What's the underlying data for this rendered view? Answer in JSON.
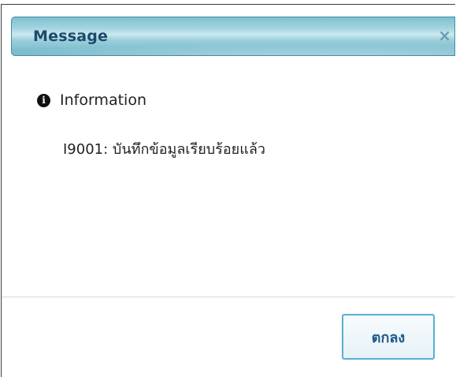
{
  "dialog": {
    "title": "Message",
    "close_glyph": "×",
    "icon": "info-circle-icon",
    "heading": "Information",
    "message": "I9001: บันทึกข้อมูลเรียบร้อยแล้ว",
    "ok_label": "ตกลง"
  },
  "colors": {
    "title_text": "#1b4b6b",
    "titlebar_border": "#3e8ea5",
    "button_border": "#5aaed1",
    "button_text": "#1e5a88"
  }
}
